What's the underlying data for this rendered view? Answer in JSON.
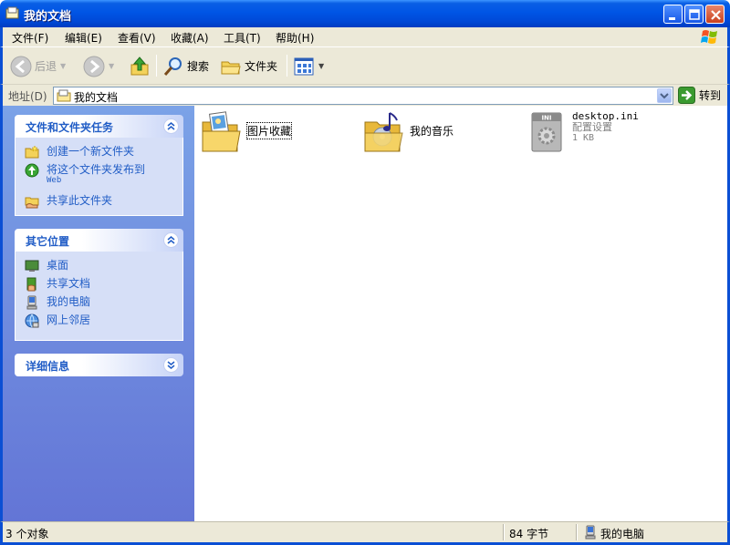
{
  "window": {
    "title": "我的文档",
    "colors": {
      "titlebar": "#0055e5",
      "taskpane": "#6375d6",
      "link": "#215dc6"
    }
  },
  "menu": {
    "items": [
      {
        "label": "文件(F)"
      },
      {
        "label": "编辑(E)"
      },
      {
        "label": "查看(V)"
      },
      {
        "label": "收藏(A)"
      },
      {
        "label": "工具(T)"
      },
      {
        "label": "帮助(H)"
      }
    ]
  },
  "toolbar": {
    "back_label": "后退",
    "search_label": "搜索",
    "folders_label": "文件夹"
  },
  "address": {
    "label": "地址(D)",
    "value": "我的文档",
    "go_label": "转到"
  },
  "taskpane": {
    "file_tasks": {
      "title": "文件和文件夹任务",
      "items": [
        {
          "label": "创建一个新文件夹",
          "icon": "new-folder-icon"
        },
        {
          "label": "将这个文件夹发布到",
          "label2": "Web",
          "icon": "publish-web-icon"
        },
        {
          "label": "共享此文件夹",
          "icon": "share-folder-icon"
        }
      ]
    },
    "other_places": {
      "title": "其它位置",
      "items": [
        {
          "label": "桌面",
          "icon": "desktop-icon"
        },
        {
          "label": "共享文档",
          "icon": "shared-documents-icon"
        },
        {
          "label": "我的电脑",
          "icon": "my-computer-icon"
        },
        {
          "label": "网上邻居",
          "icon": "network-places-icon"
        }
      ]
    },
    "details": {
      "title": "详细信息"
    }
  },
  "files": [
    {
      "name": "图片收藏",
      "icon": "pictures-folder-icon"
    },
    {
      "name": "我的音乐",
      "icon": "music-folder-icon"
    },
    {
      "name": "desktop.ini",
      "type": "配置设置",
      "size": "1 KB",
      "icon": "ini-file-icon"
    }
  ],
  "status": {
    "objects": "3 个对象",
    "size": "84 字节",
    "location": "我的电脑"
  }
}
